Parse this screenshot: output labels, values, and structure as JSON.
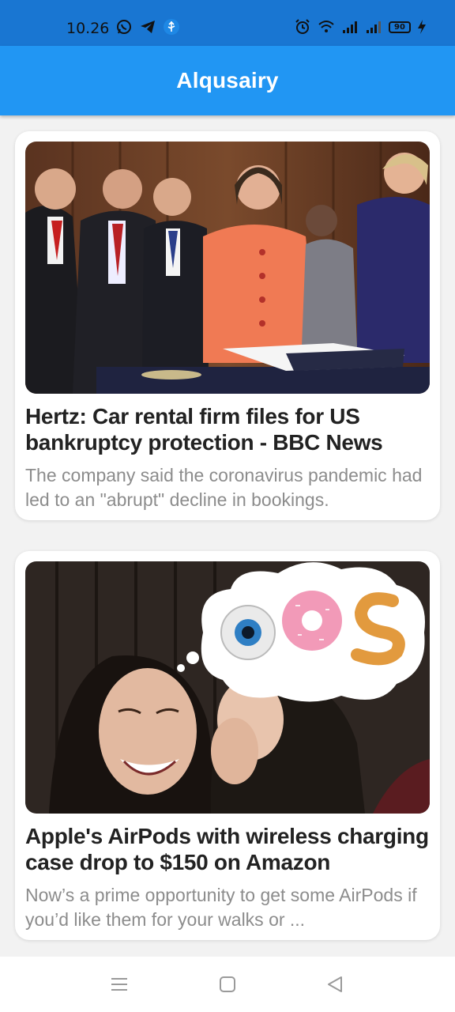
{
  "status_bar": {
    "time": "10.26",
    "battery": "90",
    "left_icons": [
      "whatsapp-icon",
      "telegram-icon",
      "usb-icon"
    ],
    "right_icons": [
      "alarm-icon",
      "wifi-icon",
      "signal-icon",
      "signal-icon",
      "battery-icon",
      "charging-icon"
    ]
  },
  "app_bar": {
    "title": "Alqusairy",
    "color": "#2196f3"
  },
  "articles": [
    {
      "title": "Hertz: Car rental firm files for US bankruptcy protection - BBC News",
      "description": "The company said the coronavirus pandemic had led to an \"abrupt\" decline in bookings."
    },
    {
      "title": "Apple's AirPods with wireless charging case drop to $150 on Amazon",
      "description": "Now’s a prime opportunity to get some AirPods if you’d like them for your walks or ..."
    }
  ],
  "nav_bar": {
    "icons": [
      "menu-icon",
      "home-icon",
      "back-icon"
    ]
  }
}
